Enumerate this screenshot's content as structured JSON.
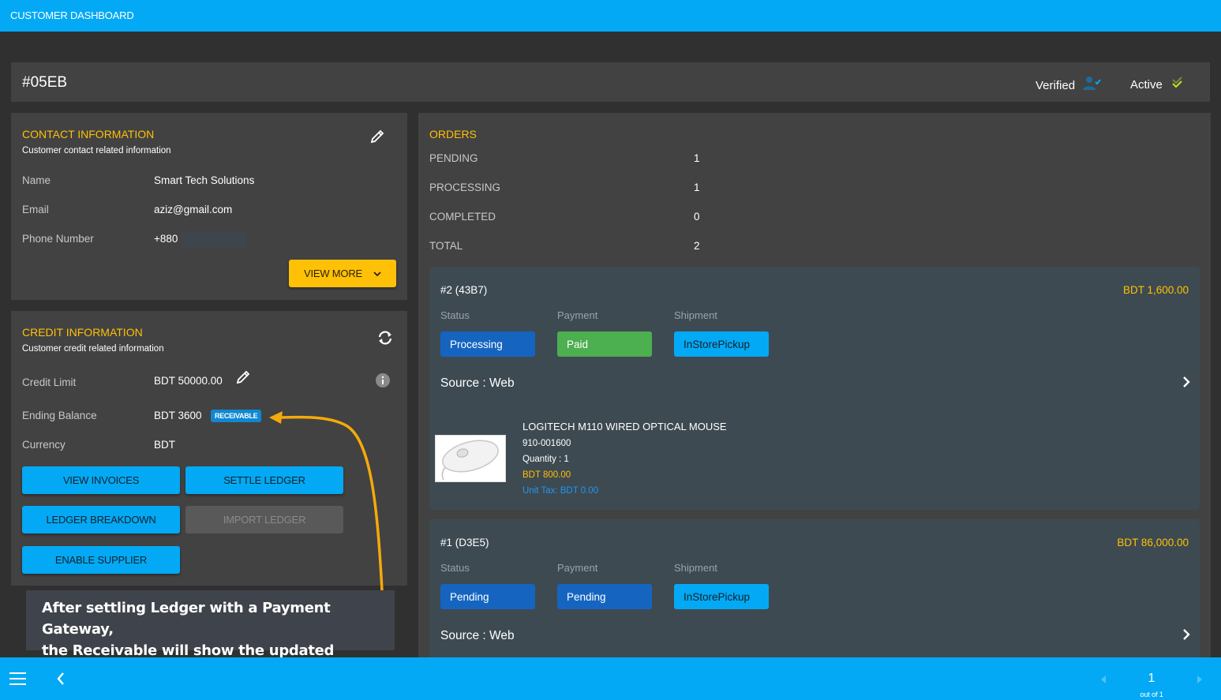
{
  "app": {
    "title": "CUSTOMER DASHBOARD"
  },
  "header": {
    "customer_id": "#05EB",
    "verified_label": "Verified",
    "verified_icon": "user-check-icon",
    "active_label": "Active",
    "active_icon": "double-check-icon"
  },
  "contact": {
    "title": "CONTACT INFORMATION",
    "subtitle": "Customer contact related information",
    "edit_icon": "pencil-icon",
    "rows": [
      {
        "label": "Name",
        "value": "Smart Tech Solutions"
      },
      {
        "label": "Email",
        "value": "aziz@gmail.com"
      },
      {
        "label": "Phone Number",
        "value": "+880"
      }
    ],
    "view_more_label": "VIEW MORE"
  },
  "credit": {
    "title": "CREDIT INFORMATION",
    "subtitle": "Customer credit related information",
    "refresh_icon": "sync-icon",
    "info_icon": "info-icon",
    "rows": [
      {
        "label": "Credit Limit",
        "value": "BDT 50000.00"
      },
      {
        "label": "Ending Balance",
        "value": "BDT 3600",
        "badge": "RECEIVABLE"
      },
      {
        "label": "Currency",
        "value": "BDT"
      }
    ],
    "buttons": {
      "view_invoices": "VIEW INVOICES",
      "settle_ledger": "SETTLE LEDGER",
      "ledger_breakdown": "LEDGER BREAKDOWN",
      "import_ledger": "IMPORT LEDGER",
      "enable_supplier": "ENABLE SUPPLIER"
    }
  },
  "orders": {
    "title": "ORDERS",
    "summary": [
      {
        "label": "PENDING",
        "value": "1"
      },
      {
        "label": "PROCESSING",
        "value": "1"
      },
      {
        "label": "COMPLETED",
        "value": "0"
      },
      {
        "label": "TOTAL",
        "value": "2"
      }
    ],
    "column_labels": {
      "status": "Status",
      "payment": "Payment",
      "shipment": "Shipment"
    },
    "list": [
      {
        "id": "#2 (43B7)",
        "amount": "BDT 1,600.00",
        "status": "Processing",
        "payment": "Paid",
        "shipment": "InStorePickup",
        "source": "Source : Web",
        "product": {
          "name": "LOGITECH M110 WIRED OPTICAL MOUSE",
          "sku": "910-001600",
          "quantity": "Quantity : 1",
          "price": "BDT 800.00",
          "unit_tax": "Unit Tax: BDT 0.00"
        }
      },
      {
        "id": "#1 (D3E5)",
        "amount": "BDT 86,000.00",
        "status": "Pending",
        "payment": "Pending",
        "shipment": "InStorePickup",
        "source": "Source : Web"
      }
    ]
  },
  "annotation": {
    "line1": "After settling Ledger with a Payment Gateway,",
    "line2": "the Receivable will show the updated balance"
  },
  "pagination": {
    "current": "1",
    "out_of": "out of 1"
  },
  "colors": {
    "primary": "#03a9f4",
    "accent": "#ffc107",
    "processing": "#1565c0",
    "paid": "#4caf50",
    "badge": "#0f88d2"
  }
}
